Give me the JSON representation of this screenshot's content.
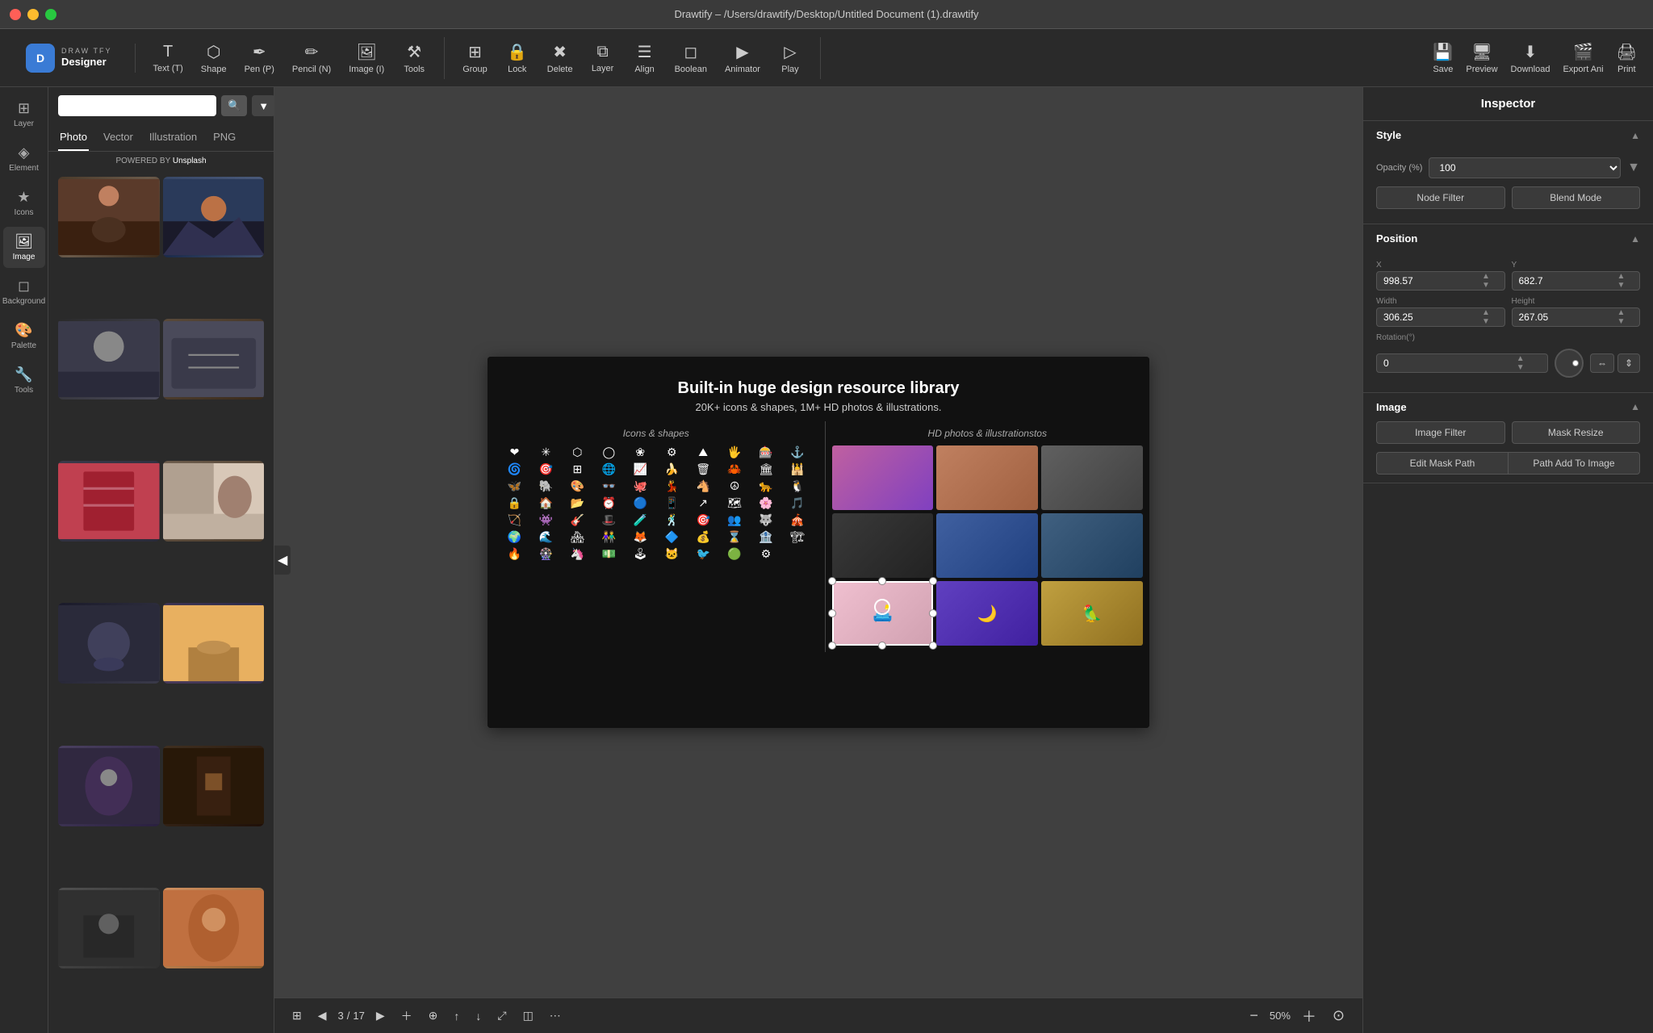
{
  "app": {
    "title": "Drawtify – /Users/drawtify/Desktop/Untitled Document (1).drawtify"
  },
  "toolbar": {
    "tools": [
      {
        "id": "text",
        "icon": "T",
        "label": "Text (T)"
      },
      {
        "id": "shape",
        "icon": "⬡",
        "label": "Shape"
      },
      {
        "id": "pen",
        "icon": "✒",
        "label": "Pen (P)"
      },
      {
        "id": "pencil",
        "icon": "✏",
        "label": "Pencil (N)"
      },
      {
        "id": "image",
        "icon": "🖼",
        "label": "Image (I)"
      },
      {
        "id": "tools",
        "icon": "⚙",
        "label": "Tools"
      }
    ],
    "actions": [
      {
        "id": "group",
        "icon": "⊞",
        "label": "Group"
      },
      {
        "id": "lock",
        "icon": "🔒",
        "label": "Lock"
      },
      {
        "id": "delete",
        "icon": "✖",
        "label": "Delete"
      },
      {
        "id": "layer",
        "icon": "⧉",
        "label": "Layer"
      },
      {
        "id": "align",
        "icon": "≡",
        "label": "Align"
      },
      {
        "id": "boolean",
        "icon": "◻",
        "label": "Boolean"
      },
      {
        "id": "animator",
        "icon": "▶",
        "label": "Animator"
      },
      {
        "id": "play",
        "icon": "▷",
        "label": "Play"
      }
    ],
    "right_actions": [
      {
        "id": "save",
        "icon": "💾",
        "label": "Save"
      },
      {
        "id": "preview",
        "icon": "🖥",
        "label": "Preview"
      },
      {
        "id": "download",
        "icon": "⬇",
        "label": "Download"
      },
      {
        "id": "export_ani",
        "icon": "📽",
        "label": "Export Ani"
      },
      {
        "id": "print",
        "icon": "🖨",
        "label": "Print"
      }
    ]
  },
  "sidebar": {
    "items": [
      {
        "id": "layer",
        "icon": "⊞",
        "label": "Layer"
      },
      {
        "id": "element",
        "icon": "◈",
        "label": "Element"
      },
      {
        "id": "icons",
        "icon": "★",
        "label": "Icons"
      },
      {
        "id": "image",
        "icon": "🖼",
        "label": "Image",
        "active": true
      },
      {
        "id": "background",
        "icon": "◻",
        "label": "Background"
      },
      {
        "id": "palette",
        "icon": "🎨",
        "label": "Palette"
      },
      {
        "id": "tools",
        "icon": "🔧",
        "label": "Tools"
      }
    ]
  },
  "panel": {
    "search_placeholder": "",
    "tabs": [
      {
        "id": "photo",
        "label": "Photo",
        "active": true
      },
      {
        "id": "vector",
        "label": "Vector"
      },
      {
        "id": "illustration",
        "label": "Illustration"
      },
      {
        "id": "png",
        "label": "PNG"
      }
    ],
    "powered_by": "POWERED BY",
    "unsplash": "Unsplash"
  },
  "canvas": {
    "title_main": "Built-in huge design resource library",
    "title_sub": "20K+ icons & shapes, 1M+ HD photos & illustrations.",
    "left_col_title": "Icons & shapes",
    "right_col_title": "HD photos & illustrationstos"
  },
  "bottom_bar": {
    "current_page": "3",
    "total_pages": "17",
    "zoom_label": "50%",
    "zoom_value": "50"
  },
  "inspector": {
    "title": "Inspector",
    "style_section": "Style",
    "opacity_label": "Opacity (%)",
    "opacity_value": "100",
    "node_filter": "Node Filter",
    "blend_mode": "Blend Mode",
    "position_section": "Position",
    "x_label": "X",
    "x_value": "998.57",
    "y_label": "Y",
    "y_value": "682.7",
    "width_label": "Width",
    "width_value": "306.25",
    "height_label": "Height",
    "height_value": "267.05",
    "rotation_label": "Rotation(°)",
    "rotation_value": "0",
    "image_section": "Image",
    "image_filter_btn": "Image Filter",
    "mask_resize_btn": "Mask Resize",
    "edit_mask_path_btn": "Edit Mask Path",
    "path_add_to_image_btn": "Path Add To Image"
  }
}
